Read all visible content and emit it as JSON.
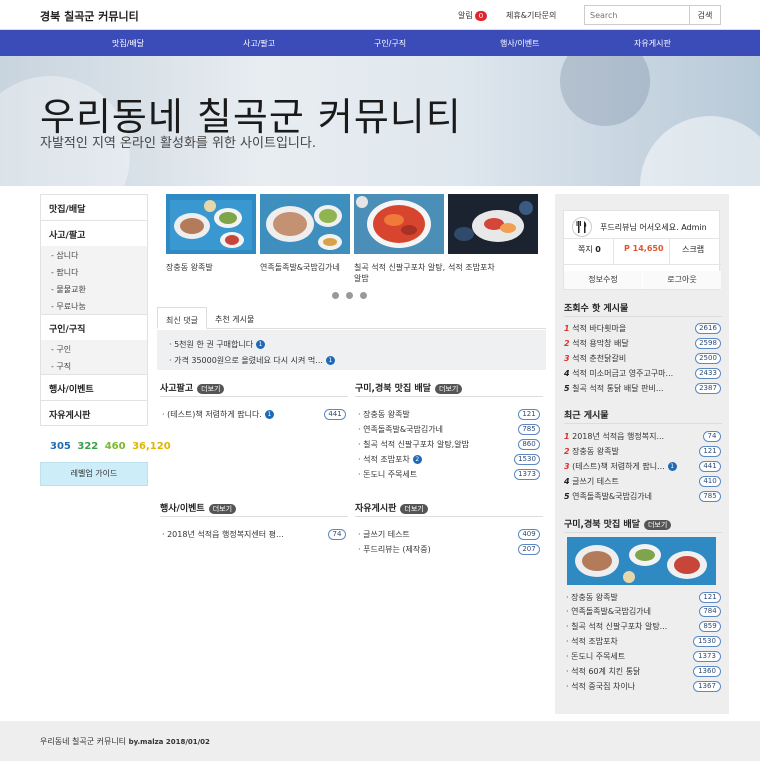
{
  "header": {
    "site_title": "경북 칠곡군 커뮤니티",
    "alarm_label": "알림",
    "alarm_count": "0",
    "partner_link": "제휴&기타문의",
    "search_placeholder": "Search",
    "search_button": "검색"
  },
  "main_nav": [
    "맛집/배달",
    "사고/팔고",
    "구인/구직",
    "행사/이벤트",
    "자유게시판"
  ],
  "hero": {
    "title": "우리동네 칠곡군 커뮤니티",
    "subtitle": "자발적인 지역 온라인 활성화를 위한 사이트입니다."
  },
  "left_nav": {
    "cat_food": "맛집/배달",
    "cat_trade": "사고/팔고",
    "trade_subs": [
      "- 삽니다",
      "- 팝니다",
      "- 물물교환",
      "- 무료나눔"
    ],
    "cat_job": "구인/구직",
    "job_subs": [
      "- 구인",
      "- 구직"
    ],
    "cat_event": "행사/이벤트",
    "cat_free": "자유게시판",
    "stats": [
      "305",
      "322",
      "460",
      "36,120"
    ],
    "level_guide": "레벨업 가이드"
  },
  "slider": {
    "captions": [
      "장충동 왕족발",
      "연족돌족발&국밥김가네",
      "칠곡 석적 신팔구포차 알탕,알밥",
      "석적 조밥포차"
    ]
  },
  "tabs": [
    "최신 댓글",
    "추천 게시물"
  ],
  "recent_comments": [
    {
      "text": "5천원 한 권 구매합니다",
      "badge": "1"
    },
    {
      "text": "가격 35000원으로 올렸네요 다시 시켜 먹...",
      "badge": "1"
    }
  ],
  "sections": {
    "more_label": "더보기",
    "trade": {
      "title": "사고팔고",
      "items": [
        {
          "text": "(테스트)책 저렴하게 팝니다.",
          "badge": "1",
          "count": "441"
        }
      ]
    },
    "food": {
      "title": "구미,경북 맛집 배달",
      "items": [
        {
          "text": "장충동 왕족발",
          "count": "121"
        },
        {
          "text": "연족돌족발&국밥김가네",
          "count": "785"
        },
        {
          "text": "칠곡 석적 신팔구포차 알탕,알밥",
          "count": "860"
        },
        {
          "text": "석적 조밥포차",
          "badge": "2",
          "count": "1530"
        },
        {
          "text": "돈도니 주목세트",
          "count": "1373"
        }
      ]
    },
    "event": {
      "title": "행사/이벤트",
      "items": [
        {
          "text": "2018년 석적읍 행정복지센터 평...",
          "count": "74"
        }
      ]
    },
    "free": {
      "title": "자유게시판",
      "items": [
        {
          "text": "글쓰기 테스트",
          "count": "409"
        },
        {
          "text": "푸드리뷰는 (제작중)",
          "count": "207"
        }
      ]
    }
  },
  "profile": {
    "greeting": "푸드리뷰님 어서오세요. Admin",
    "note_label": "쪽지",
    "note_count": "0",
    "points": "P 14,650",
    "scrap": "스크랩",
    "edit": "정보수정",
    "logout": "로그아웃"
  },
  "popular": {
    "title": "조회수 핫 게시물",
    "items": [
      {
        "rank": "1",
        "text": "석적 바다횟마을",
        "count": "2616"
      },
      {
        "rank": "2",
        "text": "석적 용막창 배달",
        "count": "2598"
      },
      {
        "rank": "3",
        "text": "석적 춘천닭갈비",
        "count": "2500"
      },
      {
        "rank": "4",
        "text": "석적 미소머금고 영주고구마...",
        "count": "2433"
      },
      {
        "rank": "5",
        "text": "칠곡 석적 통닭 배달 판비...",
        "count": "2387"
      }
    ]
  },
  "latest": {
    "title": "최근 게시물",
    "items": [
      {
        "rank": "1",
        "text": "2018년 석적읍 행정복지...",
        "count": "74"
      },
      {
        "rank": "2",
        "text": "장충동 왕족발",
        "count": "121"
      },
      {
        "rank": "3",
        "text": "(테스트)책 저렴하게 팝니...",
        "badge": "1",
        "count": "441"
      },
      {
        "rank": "4",
        "text": "글쓰기 테스트",
        "count": "410"
      },
      {
        "rank": "5",
        "text": "연족돌족발&국밥김가네",
        "count": "785"
      }
    ]
  },
  "food_side": {
    "title": "구미,경북 맛집 배달",
    "items": [
      {
        "text": "장충동 왕족발",
        "count": "121"
      },
      {
        "text": "연족돌족발&국밥김가네",
        "count": "784"
      },
      {
        "text": "칠곡 석적 신팔구포차 알탕...",
        "count": "859"
      },
      {
        "text": "석적 조밥포차",
        "count": "1530"
      },
      {
        "text": "돈도니 주목세트",
        "count": "1373"
      },
      {
        "text": "석적 60계 치킨 통닭",
        "count": "1360"
      },
      {
        "text": "석적 중국집 차이나",
        "count": "1367"
      }
    ]
  },
  "footer": {
    "text": "우리동네 칠곡군 커뮤니티",
    "credit": "by.malza 2018/01/02"
  },
  "colors": {
    "nav_blue": "#3b4cb8",
    "rank_red": "#dd3333",
    "badge_blue": "#2169b6",
    "level_cyan": "#cdeef8",
    "stat_1": "#1f6bb3",
    "stat_2": "#3a9e4a",
    "stat_3": "#7ab82e",
    "stat_4": "#e0b400"
  }
}
